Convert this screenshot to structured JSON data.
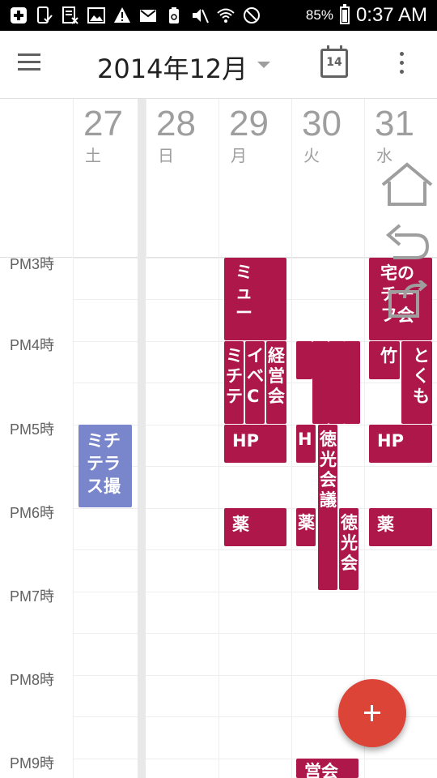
{
  "status_bar": {
    "icons": [
      "plus-box-icon",
      "phone-check-icon",
      "task-icon",
      "image-icon",
      "warning-icon",
      "mail-icon",
      "recycle-icon",
      "mute-icon",
      "wifi-icon",
      "block-icon"
    ],
    "battery_percent": "85%",
    "time": "0:37 AM"
  },
  "app_bar": {
    "title": "2014年12月",
    "today_badge": "14",
    "menu_icon": "hamburger-icon",
    "overflow_icon": "more-vert-icon"
  },
  "days": [
    {
      "date": "27",
      "weekday": "土"
    },
    {
      "date": "28",
      "weekday": "日"
    },
    {
      "date": "29",
      "weekday": "月"
    },
    {
      "date": "30",
      "weekday": "火"
    },
    {
      "date": "31",
      "weekday": "水"
    }
  ],
  "hours": [
    "PM3時",
    "PM4時",
    "PM5時",
    "PM6時",
    "PM7時",
    "PM8時",
    "PM9時"
  ],
  "colors": {
    "event_red": "#ad1749",
    "event_blue": "#7986cb",
    "fab_red": "#db4437",
    "grid": "#eeeeee"
  },
  "events": [
    {
      "day": "27",
      "text": "ミチテラス撮"
    },
    {
      "day": "29",
      "text": "ミュー"
    },
    {
      "day": "29",
      "text": "ミチテ"
    },
    {
      "day": "29",
      "text": "イベC"
    },
    {
      "day": "29",
      "text": "経営会"
    },
    {
      "day": "29",
      "text": "HP"
    },
    {
      "day": "29",
      "text": "薬"
    },
    {
      "day": "30",
      "text": ""
    },
    {
      "day": "30",
      "text": ""
    },
    {
      "day": "30",
      "text": ""
    },
    {
      "day": "30",
      "text": ""
    },
    {
      "day": "30",
      "text": "H"
    },
    {
      "day": "30",
      "text": "徳光会議"
    },
    {
      "day": "30",
      "text": "薬"
    },
    {
      "day": "30",
      "text": "徳光会"
    },
    {
      "day": "30",
      "text": "営会"
    },
    {
      "day": "31",
      "text": "宅のチーフ会"
    },
    {
      "day": "31",
      "text": "竹"
    },
    {
      "day": "31",
      "text": "とくも"
    },
    {
      "day": "31",
      "text": "HP"
    },
    {
      "day": "31",
      "text": "薬"
    }
  ],
  "overlay_nav": [
    "home-icon",
    "back-icon",
    "recent-apps-icon"
  ],
  "fab": {
    "icon": "plus-icon"
  }
}
